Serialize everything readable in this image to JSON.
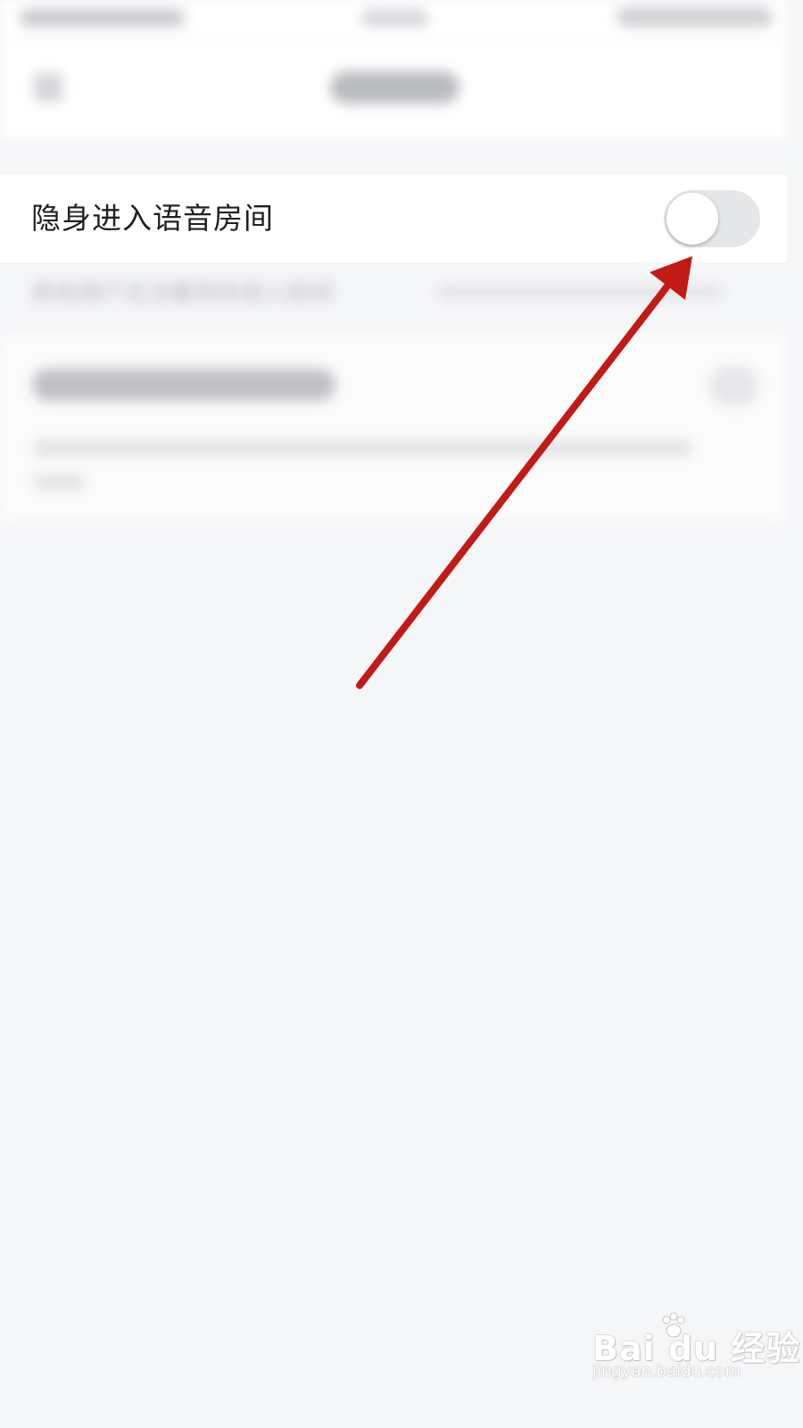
{
  "setting": {
    "label": "隐身进入语音房间",
    "toggle_on": false
  },
  "hint": {
    "text": "其他用户无法看到你进入房间"
  },
  "annotation": {
    "arrow_color": "#c21a15"
  },
  "watermark": {
    "logo": "Bai du 经验",
    "url": "jingyan.baidu.com"
  },
  "colors": {
    "background": "#f5f6f8",
    "row_background": "#ffffff",
    "toggle_track_off": "#e5e6e8"
  }
}
